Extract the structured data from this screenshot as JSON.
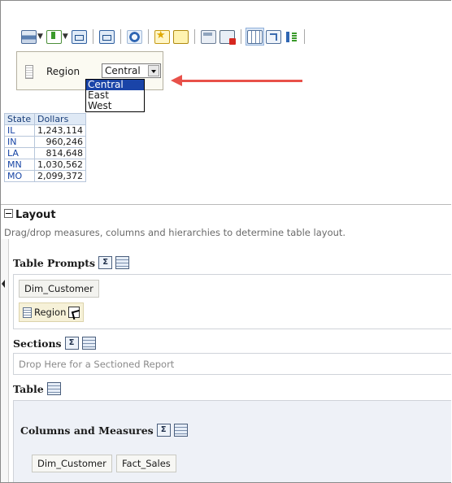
{
  "toolbar": {
    "items": [
      {
        "icon": "print-icon"
      },
      {
        "icon": "export-icon"
      },
      {
        "icon": "preview-icon"
      },
      {
        "icon": "filter-icon"
      },
      {
        "icon": "refresh-icon"
      },
      {
        "icon": "new-view-icon"
      },
      {
        "icon": "analysis-properties-icon"
      },
      {
        "icon": "edit-view-icon"
      },
      {
        "icon": "remove-view-icon"
      },
      {
        "icon": "table-view-icon"
      },
      {
        "icon": "pivot-icon"
      },
      {
        "icon": "sort-icon"
      }
    ]
  },
  "prompt": {
    "label": "Region",
    "selected": "Central",
    "options": [
      "Central",
      "East",
      "West"
    ]
  },
  "table": {
    "headers": [
      "State",
      "Dollars"
    ],
    "rows": [
      {
        "state": "IL",
        "dollars": "1,243,114"
      },
      {
        "state": "IN",
        "dollars": "960,246"
      },
      {
        "state": "LA",
        "dollars": "814,648"
      },
      {
        "state": "MN",
        "dollars": "1,030,562"
      },
      {
        "state": "MO",
        "dollars": "2,099,372"
      }
    ]
  },
  "layout": {
    "title": "Layout",
    "hint": "Drag/drop measures, columns and hierarchies to determine table layout.",
    "table_prompts": {
      "title": "Table Prompts",
      "group": "Dim_Customer",
      "item": "Region"
    },
    "sections": {
      "title": "Sections",
      "placeholder": "Drop Here for a Sectioned Report"
    },
    "table_title": "Table",
    "columns": {
      "title": "Columns and Measures",
      "groups": [
        "Dim_Customer",
        "Fact_Sales"
      ]
    }
  },
  "colors": {
    "annotation_arrow": "#e8514a",
    "selected_option": "#1a44a8",
    "header_bg": "#dfe9f5"
  }
}
